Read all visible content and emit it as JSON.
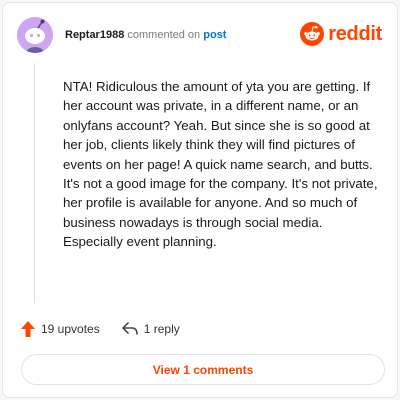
{
  "header": {
    "username": "Reptar1988",
    "action_text": "commented on",
    "link_text": "post",
    "brand_name": "reddit"
  },
  "comment": {
    "body": "NTA! Ridiculous the amount of yta you are getting. If her account was private, in a different name, or an onlyfans account? Yeah. But since she is so good at her job, clients likely think they will find pictures of events on her page! A quick name search, and butts. It's not a good image for the company. It's not private, her profile is available for anyone. And so much of business nowadays is through social media. Especially event planning."
  },
  "actions": {
    "upvotes_label": "19 upvotes",
    "reply_label": "1 reply"
  },
  "footer": {
    "view_comments_label": "View 1 comments"
  },
  "colors": {
    "brand": "#ff4500",
    "link": "#0079d3",
    "avatar_bg": "#cda6f2"
  },
  "icons": [
    "snoo-avatar-icon",
    "reddit-logo-icon",
    "upvote-arrow-icon",
    "reply-arrow-icon"
  ]
}
